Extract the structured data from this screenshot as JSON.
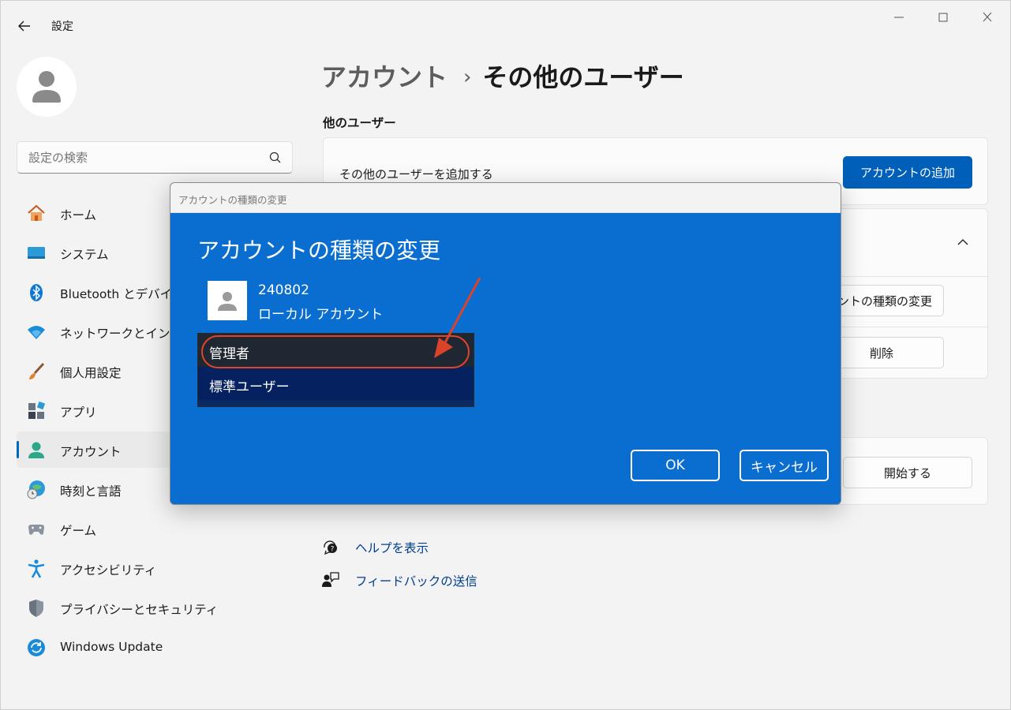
{
  "titlebar": {
    "app_title": "設定"
  },
  "search": {
    "placeholder": "設定の検索"
  },
  "sidebar": {
    "items": [
      {
        "label": "ホーム",
        "icon": "home-icon"
      },
      {
        "label": "システム",
        "icon": "system-icon"
      },
      {
        "label": "Bluetooth とデバイス",
        "icon": "bluetooth-icon"
      },
      {
        "label": "ネットワークとインターネット",
        "icon": "network-icon"
      },
      {
        "label": "個人用設定",
        "icon": "brush-icon"
      },
      {
        "label": "アプリ",
        "icon": "apps-icon"
      },
      {
        "label": "アカウント",
        "icon": "account-icon",
        "active": true
      },
      {
        "label": "時刻と言語",
        "icon": "time-language-icon"
      },
      {
        "label": "ゲーム",
        "icon": "gaming-icon"
      },
      {
        "label": "アクセシビリティ",
        "icon": "accessibility-icon"
      },
      {
        "label": "プライバシーとセキュリティ",
        "icon": "shield-icon"
      },
      {
        "label": "Windows Update",
        "icon": "update-icon"
      }
    ]
  },
  "main": {
    "breadcrumb_parent": "アカウント",
    "breadcrumb_separator": "›",
    "breadcrumb_current": "その他のユーザー",
    "section_title": "他のユーザー",
    "add_user_label": "その他のユーザーを追加する",
    "add_account_button": "アカウントの追加",
    "change_type_button": "アカウントの種類の変更",
    "delete_button": "削除",
    "start_button": "開始する",
    "help_link": "ヘルプを表示",
    "feedback_link": "フィードバックの送信"
  },
  "dialog": {
    "window_title": "アカウントの種類の変更",
    "heading": "アカウントの種類の変更",
    "user_name": "240802",
    "user_type": "ローカル アカウント",
    "options": [
      "管理者",
      "標準ユーザー"
    ],
    "selected_option": "管理者",
    "ok_button": "OK",
    "cancel_button": "キャンセル"
  },
  "colors": {
    "accent": "#005fb8",
    "dialog_bg": "#0a6ed1",
    "annotation_red": "#e0442a"
  }
}
